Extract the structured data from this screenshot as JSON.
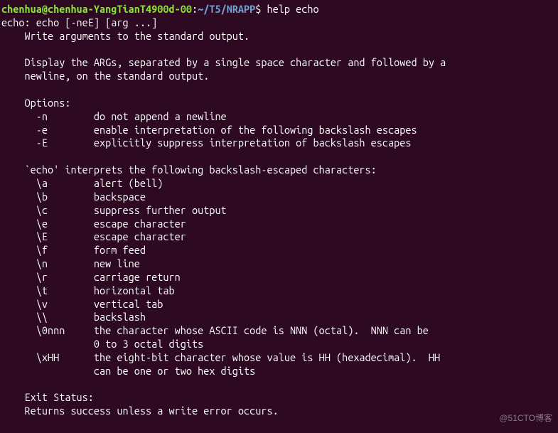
{
  "prompt": {
    "user_host": "chenhua@chenhua-YangTianT4900d-00",
    "colon": ":",
    "path": "~/T5/NRAPP",
    "dollar": "$"
  },
  "command": "help echo",
  "output": {
    "synopsis": "echo: echo [-neE] [arg ...]",
    "summary": "    Write arguments to the standard output.",
    "desc_l1": "    Display the ARGs, separated by a single space character and followed by a",
    "desc_l2": "    newline, on the standard output.",
    "options_header": "    Options:",
    "opt_n": "      -n        do not append a newline",
    "opt_e": "      -e        enable interpretation of the following backslash escapes",
    "opt_E": "      -E        explicitly suppress interpretation of backslash escapes",
    "interp_header": "    `echo' interprets the following backslash-escaped characters:",
    "esc_a": "      \\a        alert (bell)",
    "esc_b": "      \\b        backspace",
    "esc_c": "      \\c        suppress further output",
    "esc_e": "      \\e        escape character",
    "esc_E": "      \\E        escape character",
    "esc_f": "      \\f        form feed",
    "esc_n": "      \\n        new line",
    "esc_r": "      \\r        carriage return",
    "esc_t": "      \\t        horizontal tab",
    "esc_v": "      \\v        vertical tab",
    "esc_bs": "      \\\\        backslash",
    "esc_0nnn_l1": "      \\0nnn     the character whose ASCII code is NNN (octal).  NNN can be",
    "esc_0nnn_l2": "                0 to 3 octal digits",
    "esc_xHH_l1": "      \\xHH      the eight-bit character whose value is HH (hexadecimal).  HH",
    "esc_xHH_l2": "                can be one or two hex digits",
    "exit_header": "    Exit Status:",
    "exit_text": "    Returns success unless a write error occurs."
  },
  "watermark": "@51CTO博客"
}
